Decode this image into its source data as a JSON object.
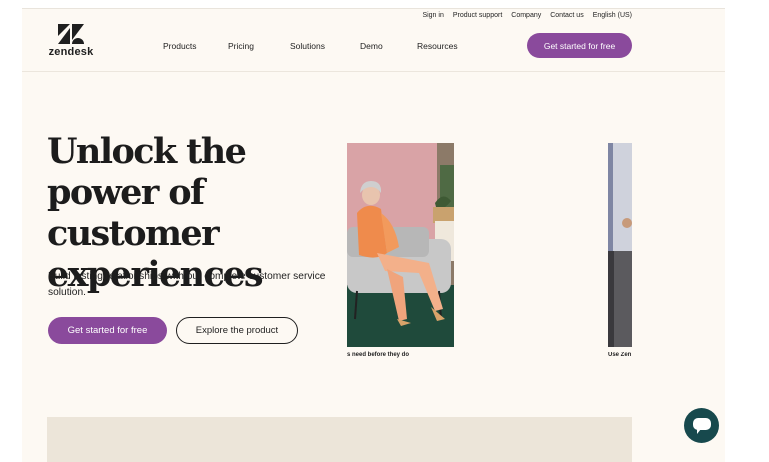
{
  "header": {
    "utility_links": [
      "Sign in",
      "Product support",
      "Company",
      "Contact us",
      "English (US)"
    ],
    "logo_text": "zendesk",
    "nav": [
      "Products",
      "Pricing",
      "Solutions",
      "Demo",
      "Resources"
    ],
    "cta_label": "Get started for free"
  },
  "hero": {
    "title": "Unlock the power of customer experiences",
    "subtitle": "Build lasting relationships with our complete customer service solution.",
    "primary_label": "Get started for free",
    "secondary_label": "Explore the product"
  },
  "carousel": {
    "card1_caption": "s need before they do",
    "card2_caption": "Use Zen"
  },
  "colors": {
    "brand_purple": "#8a4a9c",
    "page_bg": "#fdf9f3",
    "chat_teal": "#17494d"
  }
}
